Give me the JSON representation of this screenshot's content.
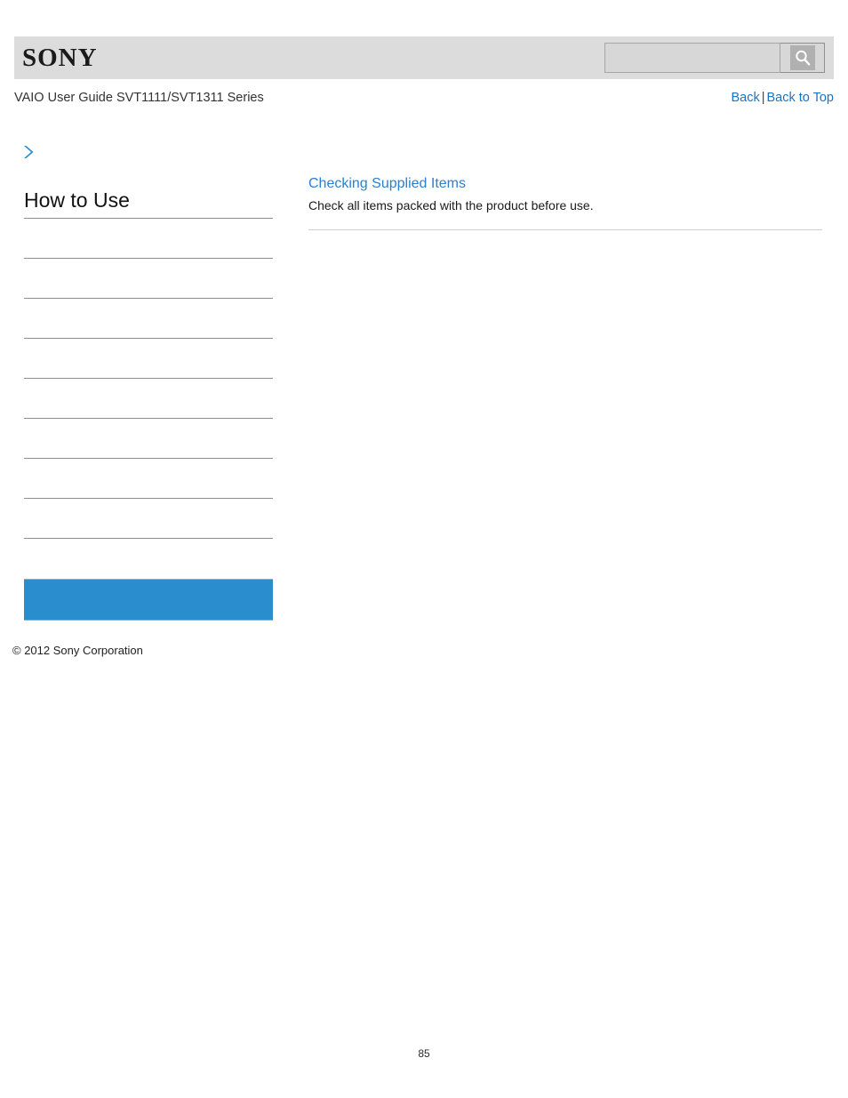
{
  "header": {
    "logo_text": "SONY",
    "logo_icon": "sony-logo",
    "search": {
      "value": "",
      "placeholder": "",
      "button_icon": "search-icon",
      "button_label": ""
    }
  },
  "subheader": {
    "guide_title": "VAIO User Guide SVT1111/SVT1311 Series",
    "back_label": "Back",
    "separator": "|",
    "back_to_top_label": "Back to Top"
  },
  "sidebar": {
    "breadcrumb_icon": "chevron-right-icon",
    "breadcrumb_label": "",
    "title": "How to Use",
    "items": [
      {
        "label": "",
        "selected": false
      },
      {
        "label": "",
        "selected": false
      },
      {
        "label": "",
        "selected": false
      },
      {
        "label": "",
        "selected": false
      },
      {
        "label": "",
        "selected": false
      },
      {
        "label": "",
        "selected": false
      },
      {
        "label": "",
        "selected": false
      },
      {
        "label": "",
        "selected": false
      }
    ],
    "selected_item": {
      "label": "",
      "selected": true
    },
    "copyright": "© 2012 Sony Corporation"
  },
  "main": {
    "topic_link": "Checking Supplied Items",
    "topic_description": "Check all items packed with the product before use."
  },
  "footer": {
    "page_number": "85"
  },
  "colors": {
    "accent_blue": "#2a8dcd",
    "link_blue": "#2a80d2",
    "nav_link_blue": "#1a72c4",
    "header_gray": "#dcdcdc",
    "divider_gray": "#8d8d8d"
  }
}
